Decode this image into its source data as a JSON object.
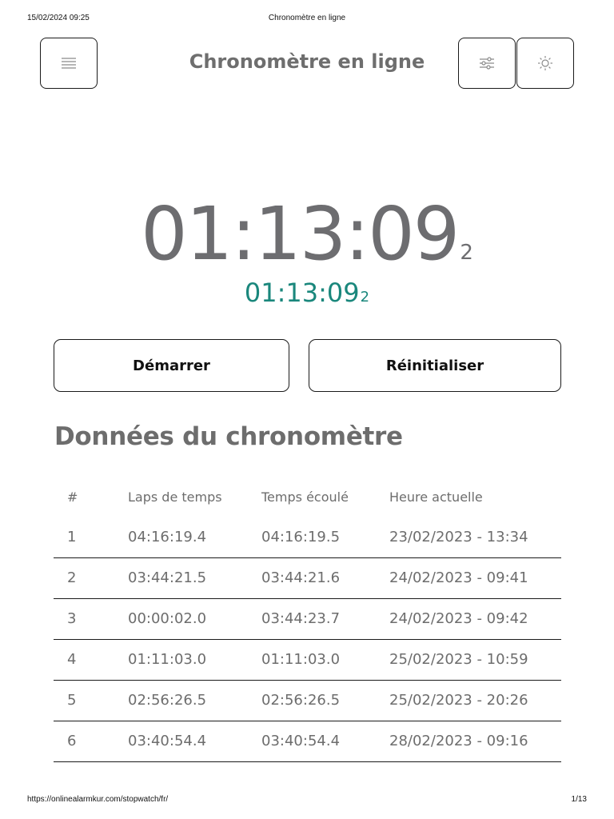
{
  "print_header": {
    "date": "15/02/2024 09:25",
    "title": "Chronomètre en ligne"
  },
  "header": {
    "title": "Chronomètre en ligne",
    "menu_icon": "hamburger-menu-icon",
    "settings_icon": "sliders-icon",
    "theme_icon": "sun-icon"
  },
  "stopwatch": {
    "main_time": "01:13:09",
    "main_tenth": "2",
    "sub_time": "01:13:09",
    "sub_tenth": "2",
    "sub_color": "#1a877c"
  },
  "buttons": {
    "start": "Démarrer",
    "reset": "Réinitialiser"
  },
  "section": {
    "title": "Données du chronomètre"
  },
  "table": {
    "headers": [
      "#",
      "Laps de temps",
      "Temps écoulé",
      "Heure actuelle"
    ],
    "rows": [
      [
        "1",
        "04:16:19.4",
        "04:16:19.5",
        "23/02/2023 - 13:34"
      ],
      [
        "2",
        "03:44:21.5",
        "03:44:21.6",
        "24/02/2023 - 09:41"
      ],
      [
        "3",
        "00:00:02.0",
        "03:44:23.7",
        "24/02/2023 - 09:42"
      ],
      [
        "4",
        "01:11:03.0",
        "01:11:03.0",
        "25/02/2023 - 10:59"
      ],
      [
        "5",
        "02:56:26.5",
        "02:56:26.5",
        "25/02/2023 - 20:26"
      ],
      [
        "6",
        "03:40:54.4",
        "03:40:54.4",
        "28/02/2023 - 09:16"
      ]
    ]
  },
  "print_footer": {
    "url": "https://onlinealarmkur.com/stopwatch/fr/",
    "page": "1/13"
  }
}
